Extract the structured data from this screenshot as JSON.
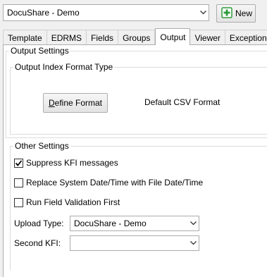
{
  "toolbar": {
    "profile_value": "DocuShare - Demo",
    "new_label": "New"
  },
  "tabs": [
    {
      "label": "Template"
    },
    {
      "label": "EDRMS"
    },
    {
      "label": "Fields"
    },
    {
      "label": "Groups"
    },
    {
      "label": "Output",
      "active": true
    },
    {
      "label": "Viewer"
    },
    {
      "label": "Exceptions"
    }
  ],
  "output_settings": {
    "legend": "Output Settings",
    "index_format": {
      "legend": "Output Index Format Type",
      "define_button_prefix": "",
      "define_button_mnemonic": "D",
      "define_button_rest": "efine Format",
      "format_value": "Default CSV Format"
    }
  },
  "other_settings": {
    "legend": "Other Settings",
    "suppress_kfi": {
      "label": "Suppress KFI messages",
      "checked": true
    },
    "replace_datetime": {
      "label": "Replace System Date/Time with File Date/Time",
      "checked": false
    },
    "run_field_validation": {
      "label": "Run Field Validation First",
      "checked": false
    },
    "upload_type": {
      "label": "Upload Type:",
      "value": "DocuShare - Demo"
    },
    "second_kfi": {
      "label": "Second KFI:",
      "value": ""
    }
  },
  "icons": {
    "new": "plus-document-icon",
    "dropdown": "chevron-down-icon",
    "check": "checkmark-icon"
  },
  "colors": {
    "window_bg": "#f0f0f0",
    "panel_bg": "#ffffff",
    "new_icon_green": "#2e9b3a"
  }
}
